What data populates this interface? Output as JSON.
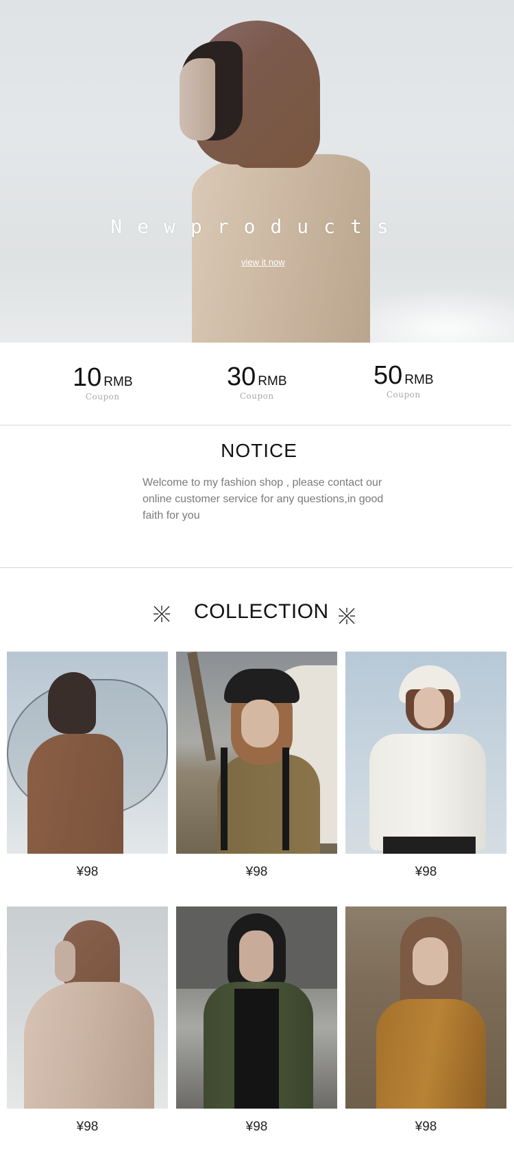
{
  "hero": {
    "title": "Newproducts",
    "link_label": "view it now"
  },
  "coupons": [
    {
      "amount": "10",
      "unit": "RMB",
      "label": "Coupon"
    },
    {
      "amount": "30",
      "unit": "RMB",
      "label": "Coupon"
    },
    {
      "amount": "50",
      "unit": "RMB",
      "label": "Coupon"
    }
  ],
  "notice": {
    "title": "NOTICE",
    "text": "Welcome to my fashion shop , please contact our online customer service for any questions,in good faith for you"
  },
  "collection": {
    "title": "COLLECTION",
    "products": [
      {
        "price": "¥98"
      },
      {
        "price": "¥98"
      },
      {
        "price": "¥98"
      },
      {
        "price": "¥98"
      },
      {
        "price": "¥98"
      },
      {
        "price": "¥98"
      }
    ]
  },
  "icons": {
    "decoration": "asterisk-cross-icon"
  },
  "colors": {
    "text": "#111111",
    "muted": "#7a7a7a",
    "divider": "#d6d6d6",
    "coupon_label": "#a9a9a9"
  }
}
